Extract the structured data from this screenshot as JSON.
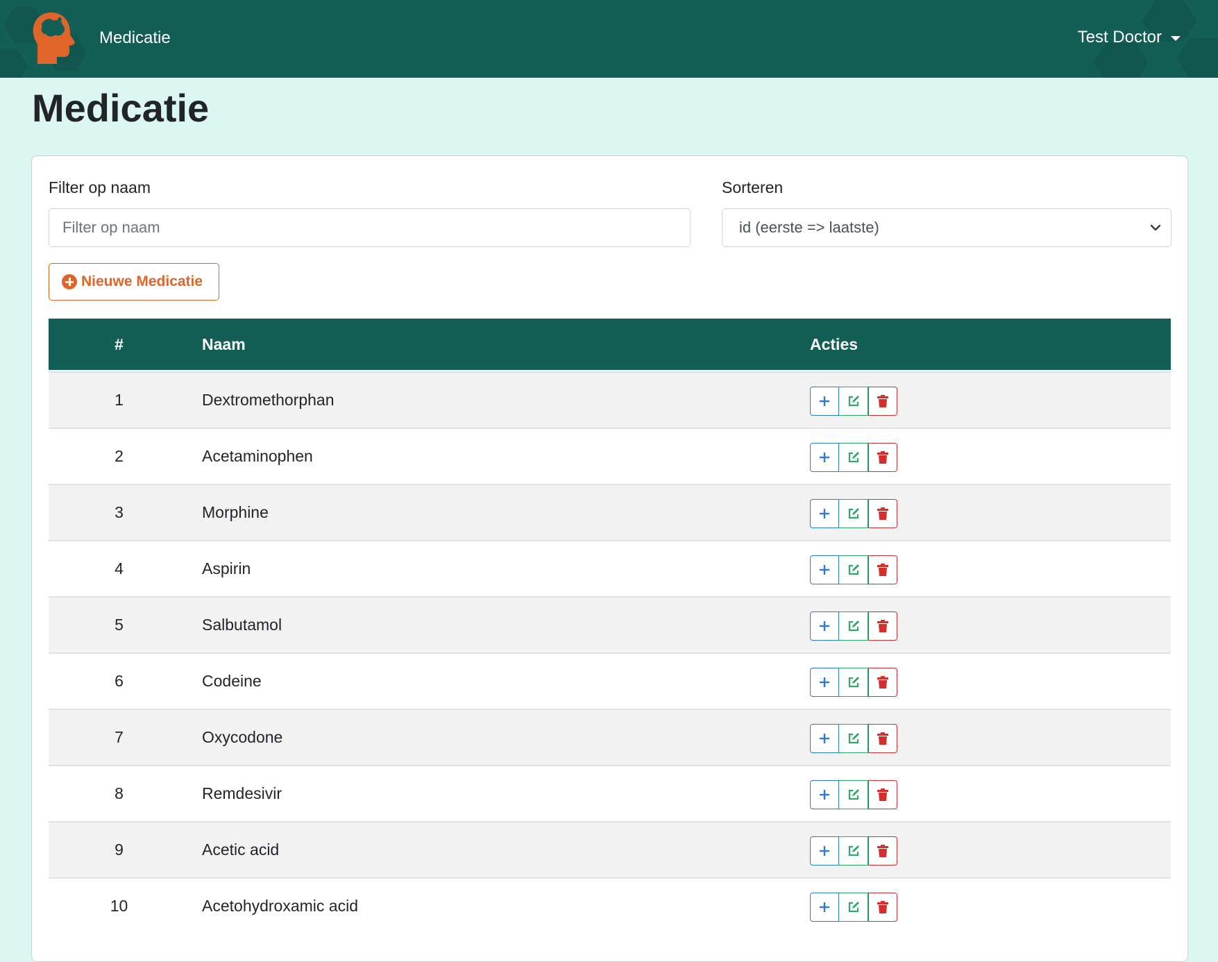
{
  "header": {
    "brand": "Medicatie",
    "user": "Test Doctor"
  },
  "page": {
    "title": "Medicatie"
  },
  "filter": {
    "label": "Filter op naam",
    "placeholder": "Filter op naam",
    "value": ""
  },
  "sort": {
    "label": "Sorteren",
    "selected": "id (eerste => laatste)"
  },
  "new_button": {
    "label": "Nieuwe Medicatie"
  },
  "table": {
    "columns": [
      "#",
      "Naam",
      "Acties"
    ],
    "rows": [
      {
        "id": "1",
        "name": "Dextromethorphan"
      },
      {
        "id": "2",
        "name": "Acetaminophen"
      },
      {
        "id": "3",
        "name": "Morphine"
      },
      {
        "id": "4",
        "name": "Aspirin"
      },
      {
        "id": "5",
        "name": "Salbutamol"
      },
      {
        "id": "6",
        "name": "Codeine"
      },
      {
        "id": "7",
        "name": "Oxycodone"
      },
      {
        "id": "8",
        "name": "Remdesivir"
      },
      {
        "id": "9",
        "name": "Acetic acid"
      },
      {
        "id": "10",
        "name": "Acetohydroxamic acid"
      }
    ],
    "actions": [
      "plus-icon",
      "edit-icon",
      "trash-icon"
    ]
  },
  "colors": {
    "navbar": "#135e55",
    "background": "#dcf7f1",
    "accent": "#e0652a",
    "add": "#2b7ad1",
    "edit": "#2ea867",
    "delete": "#d32f2f"
  }
}
